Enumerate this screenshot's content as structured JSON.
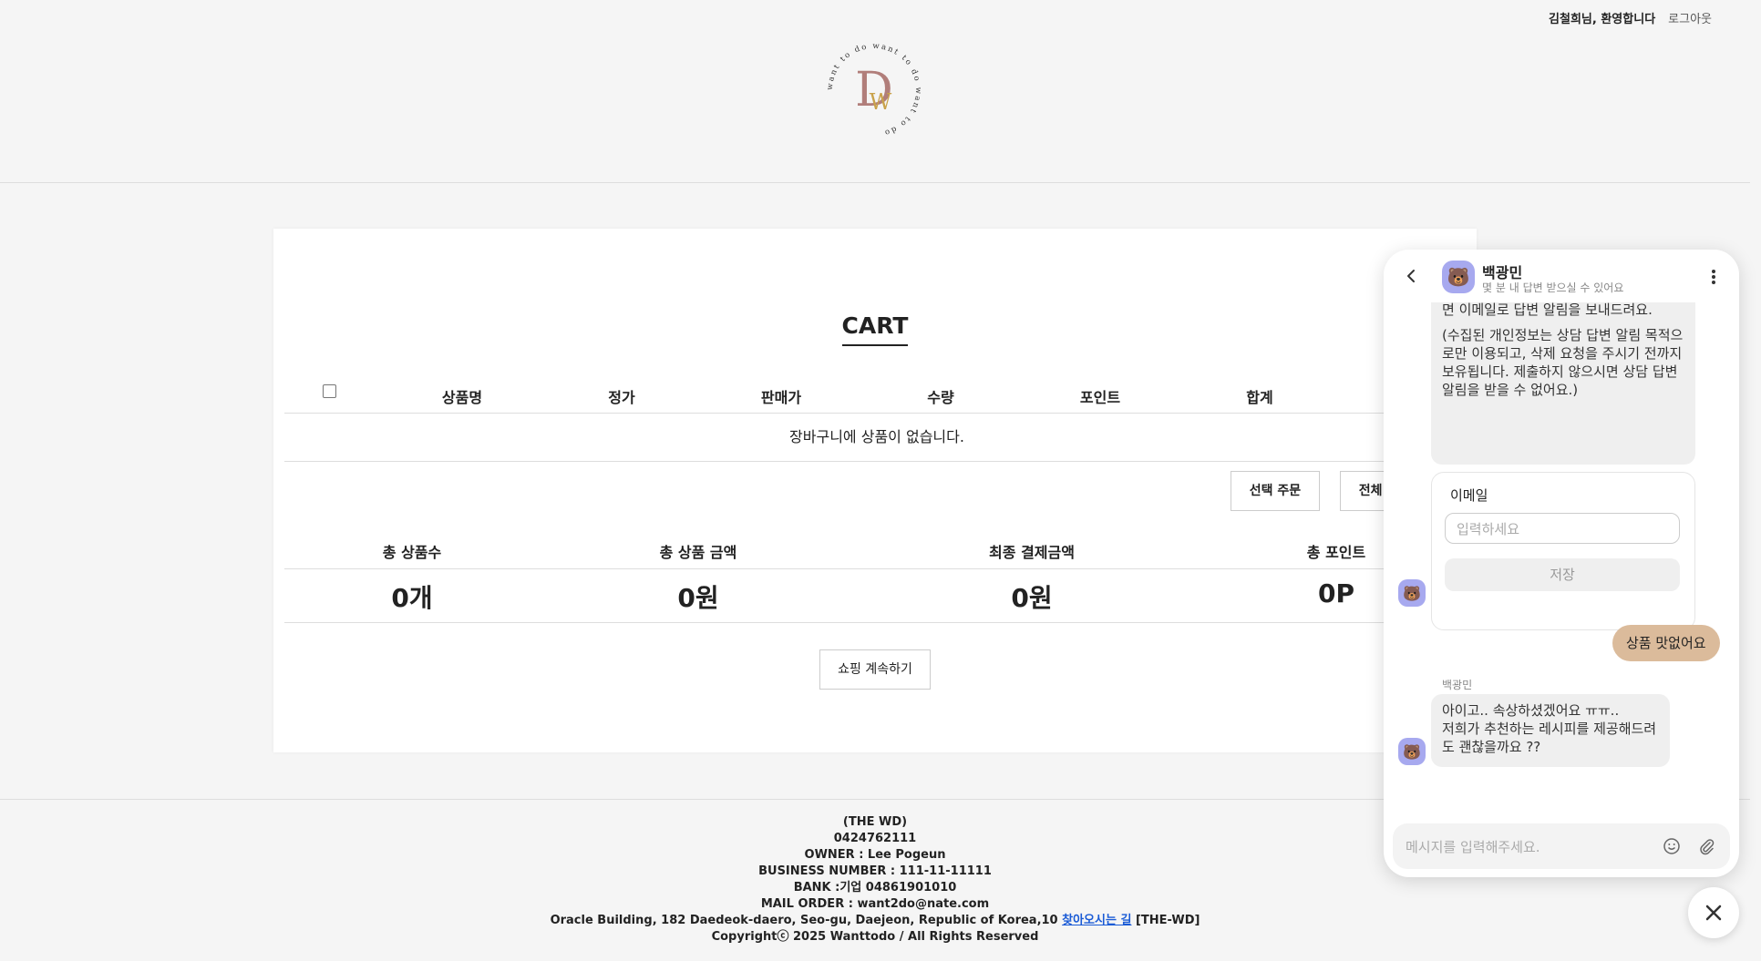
{
  "header": {
    "welcome": "김철희님, 환영합니다",
    "logout": "로그아웃",
    "logo_ring_text": "want to do want to do want to do",
    "logo_letters": "DW"
  },
  "cart": {
    "title": "CART",
    "columns": [
      "상품명",
      "정가",
      "판매가",
      "수량",
      "포인트",
      "합계"
    ],
    "empty_message": "장바구니에 상품이 없습니다.",
    "buttons": {
      "order_selected": "선택 주문",
      "order_all": "전체 주문"
    },
    "summary_headers": [
      "총 상품수",
      "총 상품 금액",
      "최종 결제금액",
      "총 포인트"
    ],
    "summary_values": [
      "0개",
      "0원",
      "0원",
      "0P"
    ],
    "continue_shopping": "쇼핑 계속하기"
  },
  "footer": {
    "company": "(THE WD)",
    "phone": "0424762111",
    "owner": "OWNER : Lee Pogeun",
    "business_number": "BUSINESS NUMBER : 111-11-11111",
    "bank": "BANK :기업 04861901010",
    "mail_order": "MAIL ORDER : want2do@nate.com",
    "address": "Oracle Building, 182 Daedeok-daero, Seo-gu, Daejeon, Republic of Korea,10",
    "directions_link": "찾아오시는 길",
    "address_suffix": "[THE-WD]",
    "copyright": "Copyrightⓒ 2025 Wanttodo / All Rights Reserved"
  },
  "chat": {
    "agent_name": "백광민",
    "agent_status": "몇 분 내 답변 받으실 수 있어요",
    "message1_p1": "연락처를 남겨주세요. 오프라인 상태가 되면 이메일로 답변 알림을 보내드려요.",
    "message1_p2": "(수집된 개인정보는 상담 답변 알림 목적으로만 이용되고, 삭제 요청을 주시기 전까지 보유됩니다. 제출하지 않으시면 상담 답변 알림을 받을 수 없어요.)",
    "email_label": "이메일",
    "email_placeholder": "입력하세요",
    "save_button": "저장",
    "user_message": "상품 맛없어요",
    "agent_name_small": "백광민",
    "message2_line1": "아이고.. 속상하셨겠어요 ㅠㅠ..",
    "message2_line2": "저희가 추천하는 레시피를 제공해드려도 괜찮을까요 ??",
    "input_placeholder": "메시지를 입력해주세요."
  }
}
